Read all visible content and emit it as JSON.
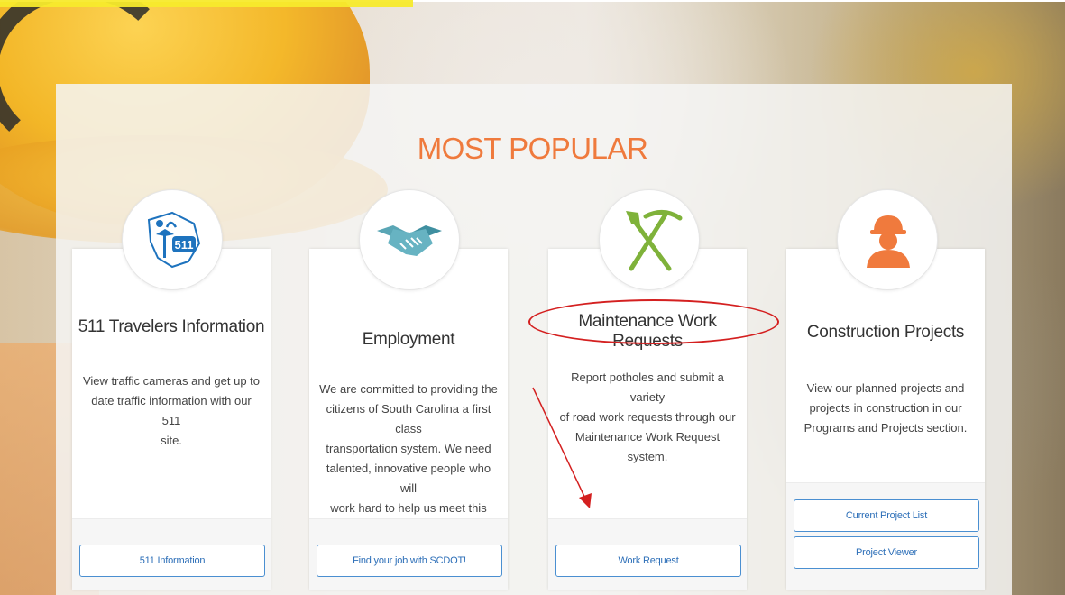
{
  "heading": "MOST POPULAR",
  "colors": {
    "accent": "#ef7a3d",
    "button_border": "#4a8fd1",
    "button_text": "#2d6fb8",
    "annotation": "#d42020"
  },
  "cards": [
    {
      "title": "511 Travelers Information",
      "icon": "south-carolina-511-icon",
      "description": [
        "View traffic cameras and get up to",
        "date traffic information with our 511",
        "site."
      ],
      "buttons": [
        "511 Information"
      ]
    },
    {
      "title": "Employment",
      "icon": "handshake-icon",
      "description": [
        "We are committed to providing the",
        "citizens of South Carolina a first class",
        "transportation system. We need",
        "talented, innovative people who will",
        "work hard to help us meet this goal."
      ],
      "buttons": [
        "Find your job with SCDOT!"
      ]
    },
    {
      "title": "Maintenance Work Requests",
      "icon": "shovel-pickaxe-icon",
      "description": [
        "Report potholes and submit a variety",
        "of road work requests through our",
        "Maintenance Work Request system."
      ],
      "buttons": [
        "Work Request"
      ]
    },
    {
      "title": "Construction Projects",
      "icon": "construction-worker-icon",
      "description": [
        "View our planned projects and",
        "projects in construction in our",
        "Programs and Projects section."
      ],
      "buttons": [
        "Current Project List",
        "Project Viewer"
      ]
    }
  ],
  "annotation": {
    "highlighted_card": "Maintenance Work Requests"
  }
}
